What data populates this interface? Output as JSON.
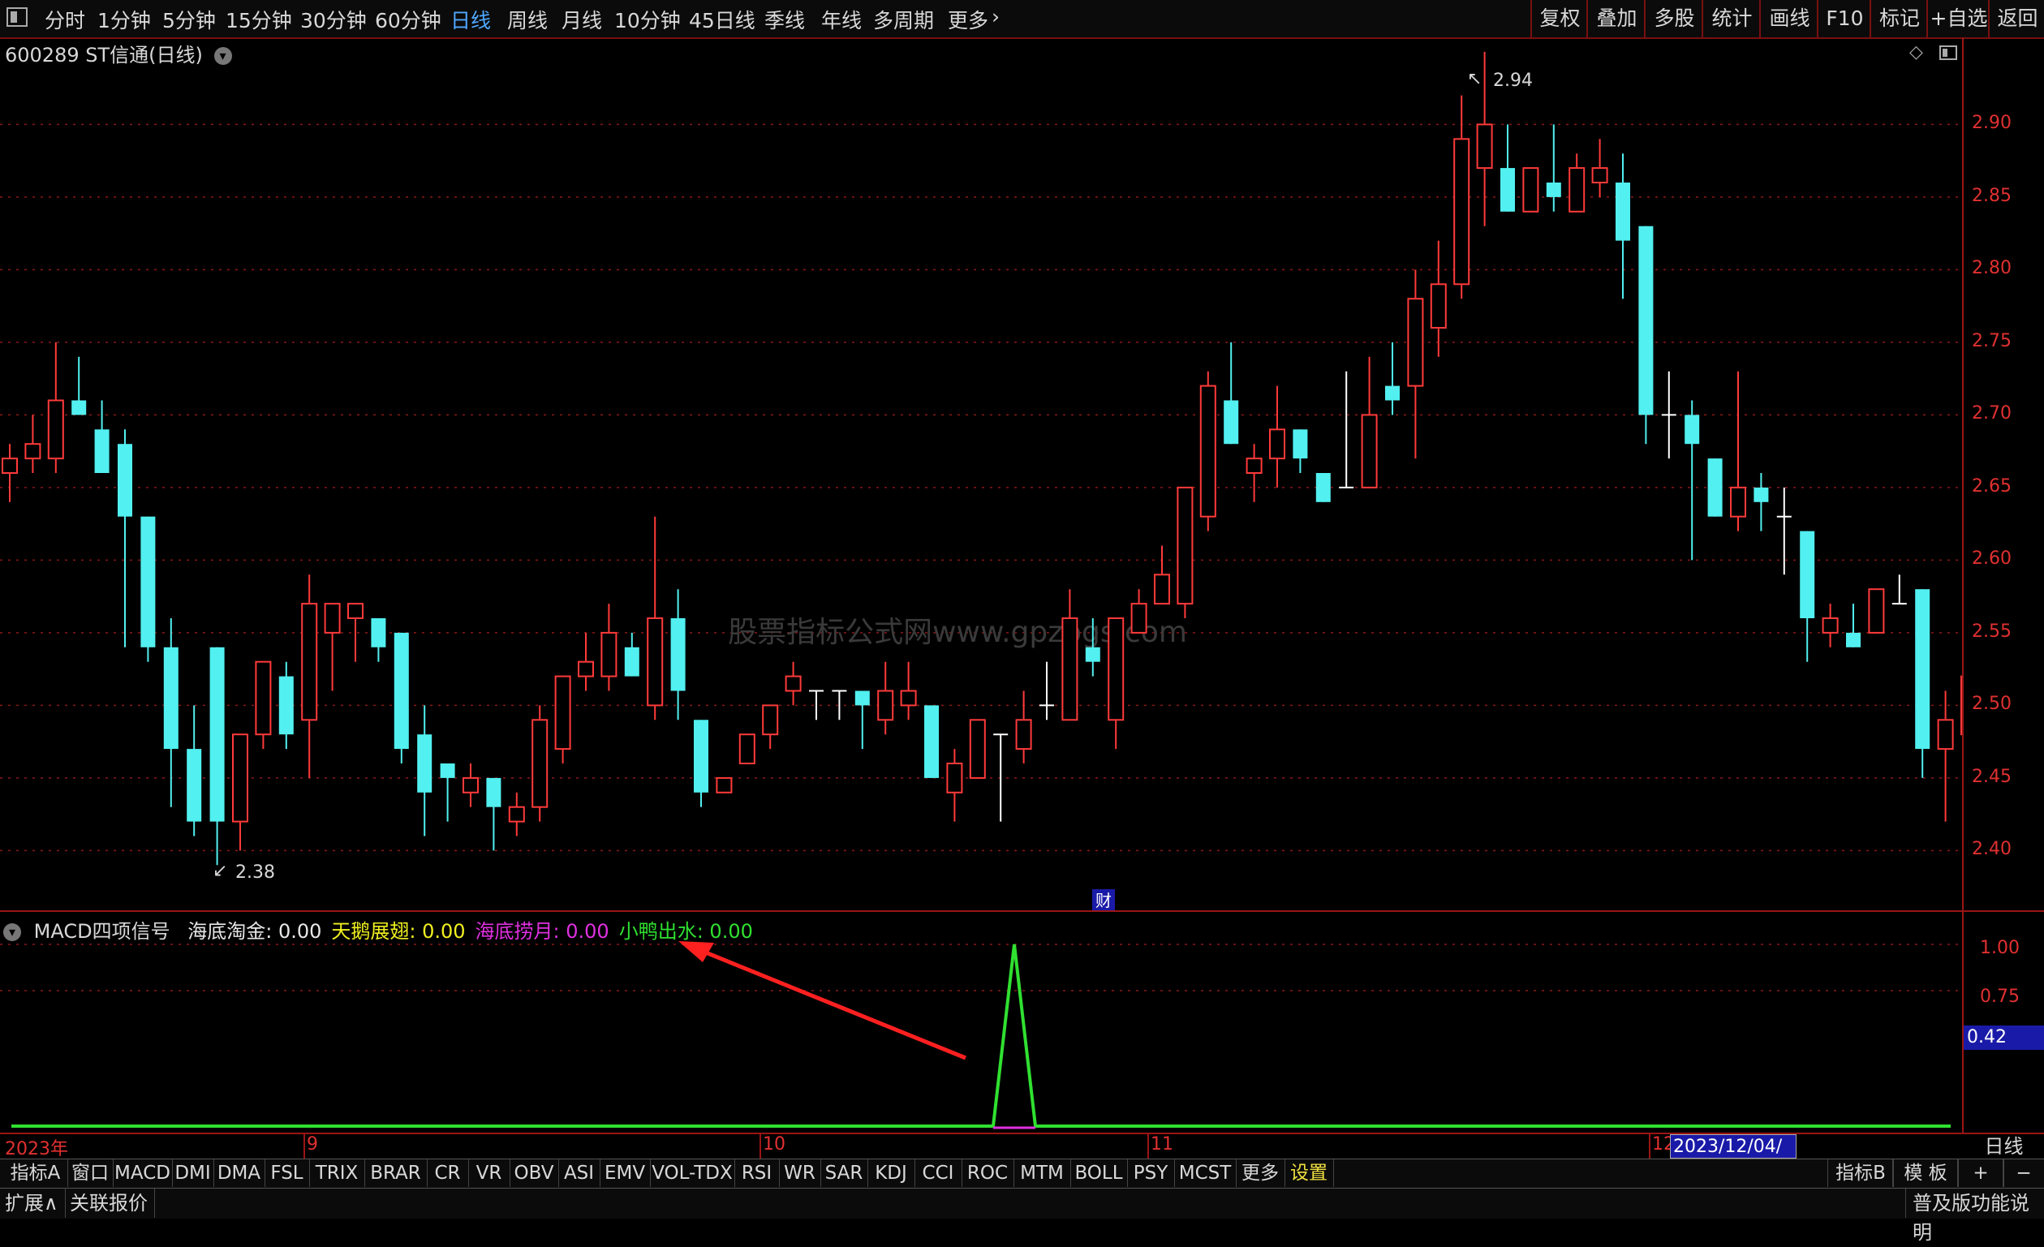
{
  "toolbar": {
    "periods": [
      "分时",
      "1分钟",
      "5分钟",
      "15分钟",
      "30分钟",
      "60分钟",
      "日线",
      "周线",
      "月线",
      "10分钟",
      "45日线",
      "季线",
      "年线",
      "多周期",
      "更多"
    ],
    "active_period": "日线",
    "right_buttons": [
      "复权",
      "叠加",
      "多股",
      "统计",
      "画线",
      "F10",
      "标记",
      "+自选",
      "返回"
    ]
  },
  "stock": {
    "title": "600289 ST信通(日线)"
  },
  "price_axis": [
    "2.90",
    "2.85",
    "2.80",
    "2.75",
    "2.70",
    "2.65",
    "2.60",
    "2.55",
    "2.50",
    "2.45",
    "2.40"
  ],
  "annotations": {
    "high": "2.94",
    "low": "2.38",
    "fin_badge": "财"
  },
  "watermark": "股票指标公式网www.gpzbgs.com",
  "indicator": {
    "name": "MACD四项信号",
    "signals": [
      {
        "label": "海底淘金",
        "value": "0.00",
        "color": "#e8e8e8"
      },
      {
        "label": "天鹅展翅",
        "value": "0.00",
        "color": "#f0f020"
      },
      {
        "label": "海底捞月",
        "value": "0.00",
        "color": "#e030e0"
      },
      {
        "label": "小鸭出水",
        "value": "0.00",
        "color": "#30e030"
      }
    ],
    "axis": [
      "1.00",
      "0.75"
    ],
    "cursor_value": "0.42"
  },
  "date_axis": {
    "ticks": [
      "2023年",
      "9",
      "10",
      "11",
      "12"
    ],
    "cursor_date": "2023/12/04/—",
    "period": "日线"
  },
  "bottom_tabs": [
    "指标A",
    "窗口",
    "MACD",
    "DMI",
    "DMA",
    "FSL",
    "TRIX",
    "BRAR",
    "CR",
    "VR",
    "OBV",
    "ASI",
    "EMV",
    "VOL-TDX",
    "RSI",
    "WR",
    "SAR",
    "KDJ",
    "CCI",
    "ROC",
    "MTM",
    "BOLL",
    "PSY",
    "MCST",
    "更多",
    "设置"
  ],
  "bottom_right_tabs": [
    "指标B",
    "模 板",
    "+",
    "−"
  ],
  "status": {
    "left": [
      "扩展∧",
      "关联报价"
    ],
    "right": "普及版功能说明"
  },
  "chart_data": {
    "type": "candlestick",
    "ylim": [
      2.36,
      2.96
    ],
    "candles": [
      {
        "o": 2.66,
        "h": 2.68,
        "l": 2.64,
        "c": 2.67
      },
      {
        "o": 2.67,
        "h": 2.7,
        "l": 2.66,
        "c": 2.68
      },
      {
        "o": 2.67,
        "h": 2.75,
        "l": 2.66,
        "c": 2.71
      },
      {
        "o": 2.71,
        "h": 2.74,
        "l": 2.7,
        "c": 2.7
      },
      {
        "o": 2.69,
        "h": 2.71,
        "l": 2.66,
        "c": 2.66
      },
      {
        "o": 2.68,
        "h": 2.69,
        "l": 2.54,
        "c": 2.63
      },
      {
        "o": 2.63,
        "h": 2.63,
        "l": 2.53,
        "c": 2.54
      },
      {
        "o": 2.54,
        "h": 2.56,
        "l": 2.43,
        "c": 2.47
      },
      {
        "o": 2.47,
        "h": 2.5,
        "l": 2.41,
        "c": 2.42
      },
      {
        "o": 2.54,
        "h": 2.54,
        "l": 2.39,
        "c": 2.42
      },
      {
        "o": 2.42,
        "h": 2.48,
        "l": 2.4,
        "c": 2.48
      },
      {
        "o": 2.48,
        "h": 2.53,
        "l": 2.47,
        "c": 2.53
      },
      {
        "o": 2.52,
        "h": 2.53,
        "l": 2.47,
        "c": 2.48
      },
      {
        "o": 2.49,
        "h": 2.59,
        "l": 2.45,
        "c": 2.57
      },
      {
        "o": 2.55,
        "h": 2.57,
        "l": 2.51,
        "c": 2.57
      },
      {
        "o": 2.56,
        "h": 2.57,
        "l": 2.53,
        "c": 2.57
      },
      {
        "o": 2.56,
        "h": 2.56,
        "l": 2.53,
        "c": 2.54
      },
      {
        "o": 2.55,
        "h": 2.55,
        "l": 2.46,
        "c": 2.47
      },
      {
        "o": 2.48,
        "h": 2.5,
        "l": 2.41,
        "c": 2.44
      },
      {
        "o": 2.46,
        "h": 2.46,
        "l": 2.42,
        "c": 2.45
      },
      {
        "o": 2.44,
        "h": 2.46,
        "l": 2.43,
        "c": 2.45
      },
      {
        "o": 2.45,
        "h": 2.45,
        "l": 2.4,
        "c": 2.43
      },
      {
        "o": 2.42,
        "h": 2.44,
        "l": 2.41,
        "c": 2.43
      },
      {
        "o": 2.43,
        "h": 2.5,
        "l": 2.42,
        "c": 2.49
      },
      {
        "o": 2.47,
        "h": 2.52,
        "l": 2.46,
        "c": 2.52
      },
      {
        "o": 2.52,
        "h": 2.55,
        "l": 2.51,
        "c": 2.53
      },
      {
        "o": 2.52,
        "h": 2.57,
        "l": 2.51,
        "c": 2.55
      },
      {
        "o": 2.54,
        "h": 2.55,
        "l": 2.52,
        "c": 2.52
      },
      {
        "o": 2.5,
        "h": 2.63,
        "l": 2.49,
        "c": 2.56
      },
      {
        "o": 2.56,
        "h": 2.58,
        "l": 2.49,
        "c": 2.51
      },
      {
        "o": 2.49,
        "h": 2.49,
        "l": 2.43,
        "c": 2.44
      },
      {
        "o": 2.44,
        "h": 2.45,
        "l": 2.44,
        "c": 2.45
      },
      {
        "o": 2.46,
        "h": 2.48,
        "l": 2.46,
        "c": 2.48
      },
      {
        "o": 2.48,
        "h": 2.5,
        "l": 2.47,
        "c": 2.5
      },
      {
        "o": 2.51,
        "h": 2.53,
        "l": 2.5,
        "c": 2.52
      },
      {
        "o": 2.51,
        "h": 2.51,
        "l": 2.49,
        "c": 2.51
      },
      {
        "o": 2.51,
        "h": 2.51,
        "l": 2.49,
        "c": 2.51
      },
      {
        "o": 2.51,
        "h": 2.51,
        "l": 2.47,
        "c": 2.5
      },
      {
        "o": 2.49,
        "h": 2.53,
        "l": 2.48,
        "c": 2.51
      },
      {
        "o": 2.5,
        "h": 2.53,
        "l": 2.49,
        "c": 2.51
      },
      {
        "o": 2.5,
        "h": 2.5,
        "l": 2.45,
        "c": 2.45
      },
      {
        "o": 2.44,
        "h": 2.47,
        "l": 2.42,
        "c": 2.46
      },
      {
        "o": 2.45,
        "h": 2.49,
        "l": 2.45,
        "c": 2.49
      },
      {
        "o": 2.48,
        "h": 2.48,
        "l": 2.42,
        "c": 2.48
      },
      {
        "o": 2.47,
        "h": 2.51,
        "l": 2.46,
        "c": 2.49
      },
      {
        "o": 2.5,
        "h": 2.53,
        "l": 2.49,
        "c": 2.5
      },
      {
        "o": 2.49,
        "h": 2.58,
        "l": 2.49,
        "c": 2.56
      },
      {
        "o": 2.54,
        "h": 2.56,
        "l": 2.52,
        "c": 2.53
      },
      {
        "o": 2.49,
        "h": 2.56,
        "l": 2.47,
        "c": 2.56
      },
      {
        "o": 2.55,
        "h": 2.58,
        "l": 2.55,
        "c": 2.57
      },
      {
        "o": 2.57,
        "h": 2.61,
        "l": 2.57,
        "c": 2.59
      },
      {
        "o": 2.57,
        "h": 2.65,
        "l": 2.56,
        "c": 2.65
      },
      {
        "o": 2.63,
        "h": 2.73,
        "l": 2.62,
        "c": 2.72
      },
      {
        "o": 2.71,
        "h": 2.75,
        "l": 2.68,
        "c": 2.68
      },
      {
        "o": 2.66,
        "h": 2.68,
        "l": 2.64,
        "c": 2.67
      },
      {
        "o": 2.67,
        "h": 2.72,
        "l": 2.65,
        "c": 2.69
      },
      {
        "o": 2.69,
        "h": 2.69,
        "l": 2.66,
        "c": 2.67
      },
      {
        "o": 2.66,
        "h": 2.66,
        "l": 2.64,
        "c": 2.64
      },
      {
        "o": 2.65,
        "h": 2.73,
        "l": 2.65,
        "c": 2.65
      },
      {
        "o": 2.65,
        "h": 2.74,
        "l": 2.65,
        "c": 2.7
      },
      {
        "o": 2.72,
        "h": 2.75,
        "l": 2.7,
        "c": 2.71
      },
      {
        "o": 2.72,
        "h": 2.8,
        "l": 2.67,
        "c": 2.78
      },
      {
        "o": 2.76,
        "h": 2.82,
        "l": 2.74,
        "c": 2.79
      },
      {
        "o": 2.79,
        "h": 2.92,
        "l": 2.78,
        "c": 2.89
      },
      {
        "o": 2.87,
        "h": 2.95,
        "l": 2.83,
        "c": 2.9
      },
      {
        "o": 2.87,
        "h": 2.9,
        "l": 2.84,
        "c": 2.84
      },
      {
        "o": 2.84,
        "h": 2.86,
        "l": 2.84,
        "c": 2.87
      },
      {
        "o": 2.86,
        "h": 2.9,
        "l": 2.84,
        "c": 2.85
      },
      {
        "o": 2.84,
        "h": 2.88,
        "l": 2.84,
        "c": 2.87
      },
      {
        "o": 2.86,
        "h": 2.89,
        "l": 2.85,
        "c": 2.87
      },
      {
        "o": 2.86,
        "h": 2.88,
        "l": 2.78,
        "c": 2.82
      },
      {
        "o": 2.83,
        "h": 2.83,
        "l": 2.68,
        "c": 2.7
      },
      {
        "o": 2.7,
        "h": 2.73,
        "l": 2.67,
        "c": 2.7
      },
      {
        "o": 2.7,
        "h": 2.71,
        "l": 2.6,
        "c": 2.68
      },
      {
        "o": 2.67,
        "h": 2.67,
        "l": 2.63,
        "c": 2.63
      },
      {
        "o": 2.63,
        "h": 2.73,
        "l": 2.62,
        "c": 2.65
      },
      {
        "o": 2.65,
        "h": 2.66,
        "l": 2.62,
        "c": 2.64
      },
      {
        "o": 2.63,
        "h": 2.65,
        "l": 2.59,
        "c": 2.63
      },
      {
        "o": 2.62,
        "h": 2.62,
        "l": 2.53,
        "c": 2.56
      },
      {
        "o": 2.55,
        "h": 2.57,
        "l": 2.54,
        "c": 2.56
      },
      {
        "o": 2.55,
        "h": 2.57,
        "l": 2.54,
        "c": 2.54
      },
      {
        "o": 2.55,
        "h": 2.58,
        "l": 2.55,
        "c": 2.58
      },
      {
        "o": 2.57,
        "h": 2.59,
        "l": 2.57,
        "c": 2.57
      },
      {
        "o": 2.58,
        "h": 2.58,
        "l": 2.45,
        "c": 2.47
      },
      {
        "o": 2.47,
        "h": 2.51,
        "l": 2.42,
        "c": 2.49
      },
      {
        "o": 2.48,
        "h": 2.55,
        "l": 2.47,
        "c": 2.52
      }
    ],
    "signal_series": {
      "小鸭出水": {
        "values_at_index": {
          "43": 1.0
        },
        "else": 0.0
      }
    }
  }
}
